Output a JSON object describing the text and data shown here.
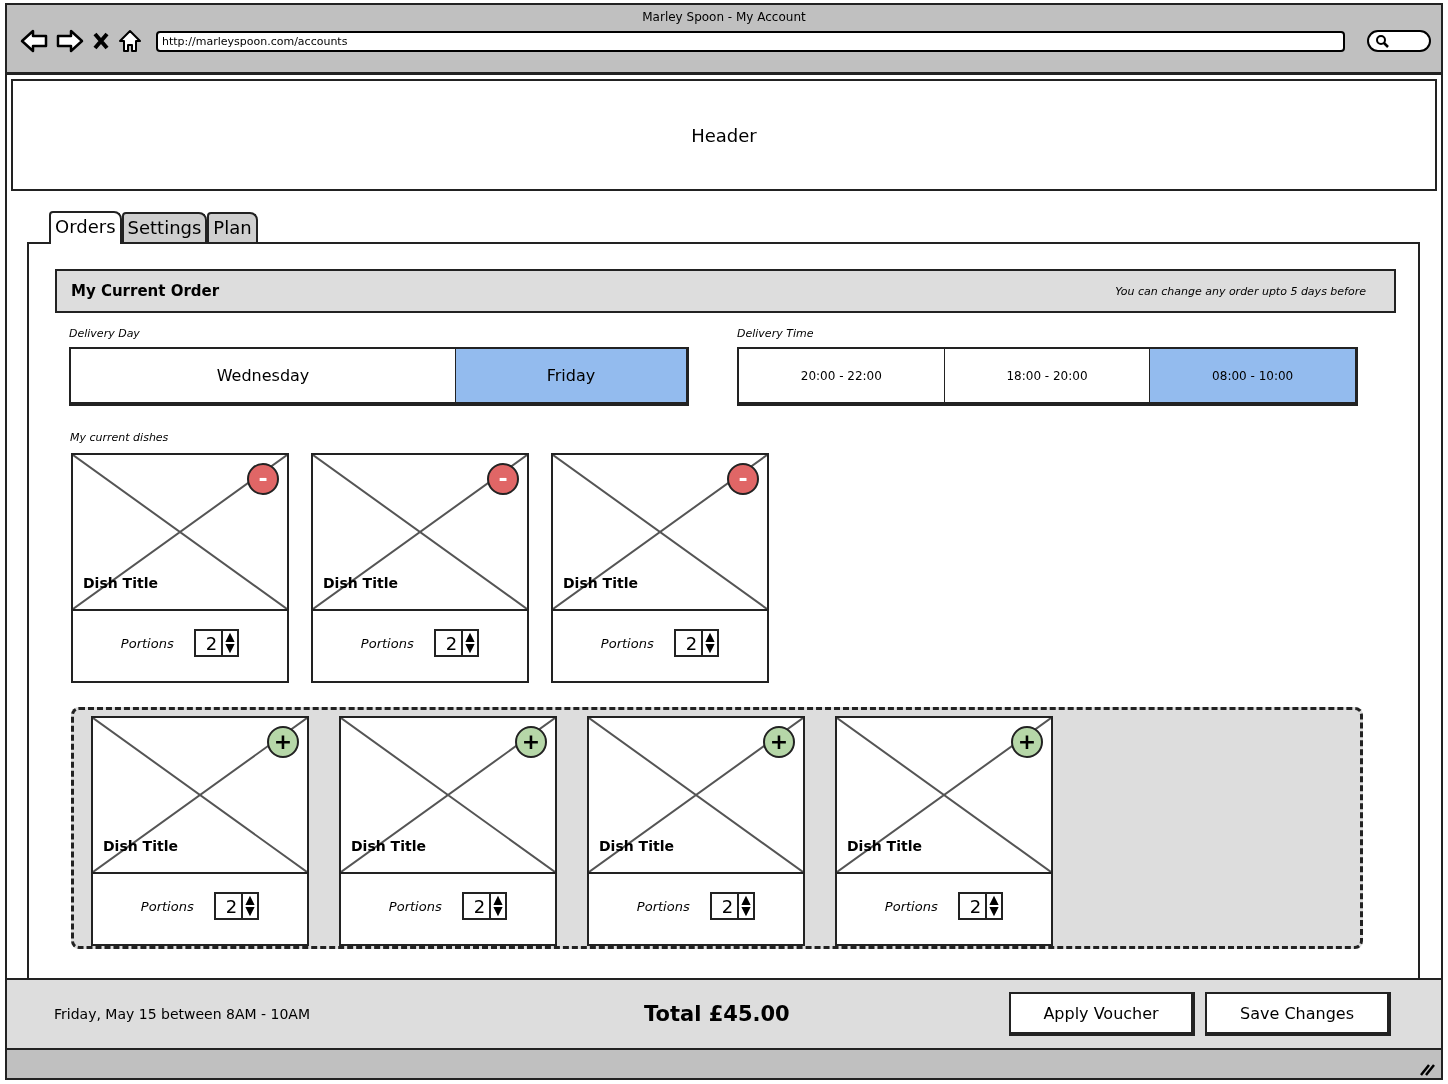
{
  "window": {
    "title": "Marley Spoon - My Account",
    "url": "http://marleyspoon.com/accounts"
  },
  "header": {
    "text": "Header"
  },
  "tabs": [
    {
      "label": "Orders",
      "selected": true
    },
    {
      "label": "Settings",
      "selected": false
    },
    {
      "label": "Plan",
      "selected": false
    }
  ],
  "order_bar": {
    "title": "My Current Order",
    "note": "You can change any order upto 5 days before"
  },
  "delivery_day": {
    "label": "Delivery Day",
    "options": [
      {
        "label": "Wednesday",
        "selected": false
      },
      {
        "label": "Friday",
        "selected": true
      }
    ]
  },
  "delivery_time": {
    "label": "Delivery Time",
    "options": [
      {
        "label": "20:00 - 22:00",
        "selected": false
      },
      {
        "label": "18:00 - 20:00",
        "selected": false
      },
      {
        "label": "08:00 - 10:00",
        "selected": true
      }
    ]
  },
  "current_dishes": {
    "label": "My current dishes",
    "items": [
      {
        "title": "Dish Title",
        "kind": "remove",
        "button_label": "-",
        "portions_label": "Portions",
        "portions": "2"
      },
      {
        "title": "Dish Title",
        "kind": "remove",
        "button_label": "-",
        "portions_label": "Portions",
        "portions": "2"
      },
      {
        "title": "Dish Title",
        "kind": "remove",
        "button_label": "-",
        "portions_label": "Portions",
        "portions": "2"
      }
    ]
  },
  "suggested_dishes": {
    "items": [
      {
        "title": "Dish Title",
        "kind": "add",
        "button_label": "+",
        "portions_label": "Portions",
        "portions": "2"
      },
      {
        "title": "Dish Title",
        "kind": "add",
        "button_label": "+",
        "portions_label": "Portions",
        "portions": "2"
      },
      {
        "title": "Dish Title",
        "kind": "add",
        "button_label": "+",
        "portions_label": "Portions",
        "portions": "2"
      },
      {
        "title": "Dish Title",
        "kind": "add",
        "button_label": "+",
        "portions_label": "Portions",
        "portions": "2"
      }
    ]
  },
  "footer": {
    "summary": "Friday, May 15 between 8AM - 10AM",
    "total": "Total £45.00",
    "buttons": [
      "Apply Voucher",
      "Save Changes"
    ]
  }
}
